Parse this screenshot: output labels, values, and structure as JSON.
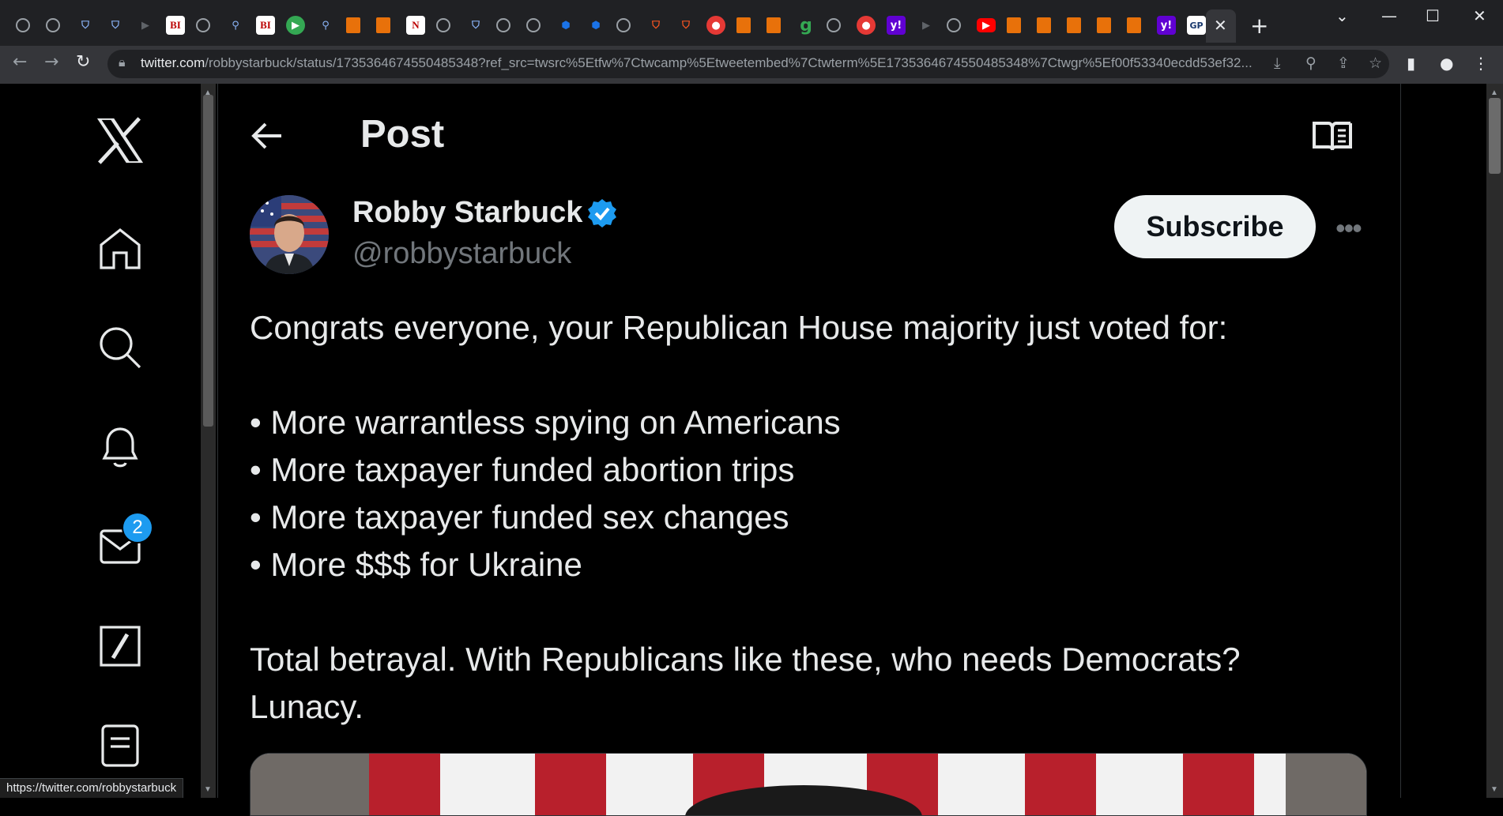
{
  "browser": {
    "url_host": "twitter.com",
    "url_path": "/robbystarbuck/status/1735364674550485348?ref_src=twsrc%5Etfw%7Ctwcamp%5Etweetembed%7Ctwterm%5E1735364674550485348%7Ctwgr%5Ef00f53340ecdd53ef32...",
    "status_url": "https://twitter.com/robbystarbuck",
    "tab_icons": [
      "globe",
      "globe",
      "shield",
      "shield",
      "dark-arrow",
      "bi",
      "globe",
      "search",
      "bi",
      "play",
      "search",
      "bookmark",
      "bookmark",
      "news",
      "globe",
      "shield",
      "globe",
      "globe",
      "blue",
      "blue",
      "globe",
      "orange-shield",
      "orange-shield",
      "red",
      "bookmark",
      "bookmark",
      "green-g",
      "globe",
      "red",
      "yahoo",
      "dark-arrow",
      "globe",
      "youtube",
      "bookmark",
      "bookmark",
      "bookmark",
      "bookmark",
      "bookmark",
      "yahoo",
      "gp"
    ]
  },
  "sidebar": {
    "items": [
      {
        "icon": "x-logo-icon"
      },
      {
        "icon": "home-icon"
      },
      {
        "icon": "search-icon"
      },
      {
        "icon": "bell-icon"
      },
      {
        "icon": "mail-icon",
        "badge": "2"
      },
      {
        "icon": "compose-icon"
      },
      {
        "icon": "lists-icon"
      }
    ]
  },
  "header": {
    "title": "Post"
  },
  "post": {
    "author_name": "Robby Starbuck",
    "author_handle": "@robbystarbuck",
    "subscribe_label": "Subscribe",
    "more_label": "•••",
    "lines": [
      "Congrats everyone, your Republican House majority just voted for:",
      "",
      "• More warrantless spying on Americans",
      "• More taxpayer funded abortion trips",
      "• More taxpayer funded sex changes",
      "• More $$$ for Ukraine",
      "",
      "Total betrayal. With Republicans like these, who needs Democrats?",
      "Lunacy."
    ]
  },
  "colors": {
    "background": "#000000",
    "text": "#e7e9ea",
    "muted": "#71767b",
    "accent": "#1d9bf0",
    "border": "#2f3336"
  }
}
